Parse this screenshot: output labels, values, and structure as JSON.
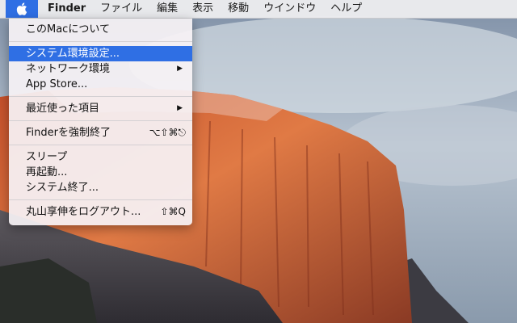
{
  "menubar": {
    "apple_icon": "apple-logo-icon",
    "items": [
      "Finder",
      "ファイル",
      "編集",
      "表示",
      "移動",
      "ウインドウ",
      "ヘルプ"
    ]
  },
  "apple_menu": {
    "about": "このMacについて",
    "system_prefs": "システム環境設定...",
    "network": "ネットワーク環境",
    "app_store": "App Store...",
    "recent_items": "最近使った項目",
    "force_quit": "Finderを強制終了",
    "force_quit_shortcut": "⌥⇧⌘⎋",
    "sleep": "スリープ",
    "restart": "再起動...",
    "shutdown": "システム終了...",
    "logout": "丸山享伸をログアウト...",
    "logout_shortcut": "⇧⌘Q",
    "submenu_arrow": "▶"
  },
  "colors": {
    "accent": "#2f6fe4"
  }
}
